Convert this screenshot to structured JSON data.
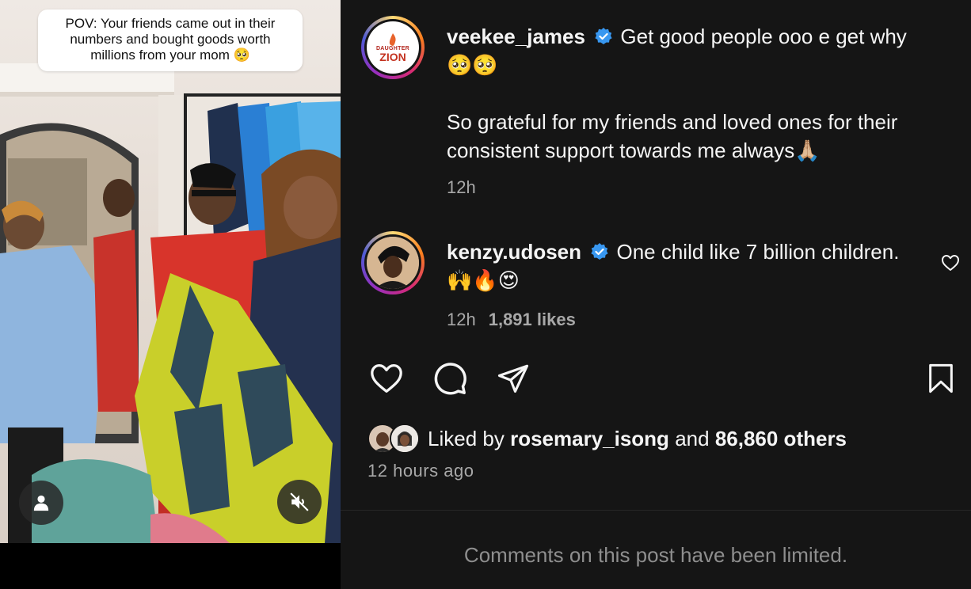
{
  "media": {
    "caption_text": "POV: Your friends came out in their numbers and bought goods worth millions from your mom 🥺",
    "icons": {
      "user_tag": "person-icon",
      "mute": "speaker-muted-icon"
    }
  },
  "post": {
    "author": {
      "username": "veekee_james",
      "avatar_text_top": "DAUGHTER",
      "avatar_text_bottom": "ZION",
      "caption_line1": "Get good people ooo e get why 🥺🥺",
      "caption_line2": "So grateful for my friends and loved ones for their consistent support towards me always🙏🏼",
      "time": "12h"
    },
    "comment": {
      "username": "kenzy.udosen",
      "text": "One child like 7 billion children. 🙌🔥😍",
      "time": "12h",
      "likes": "1,891 likes"
    }
  },
  "actions": {
    "icons": [
      "heart-icon",
      "comment-icon",
      "share-icon",
      "bookmark-icon"
    ]
  },
  "likes": {
    "prefix": "Liked by",
    "user": "rosemary_isong",
    "middle": "and",
    "others": "86,860 others"
  },
  "time_ago": "12 hours ago",
  "comments_limited": "Comments on this post have been limited.",
  "colors": {
    "panel_bg": "#151515",
    "verified": "#3897f0",
    "muted_text": "#a8a8a8"
  }
}
